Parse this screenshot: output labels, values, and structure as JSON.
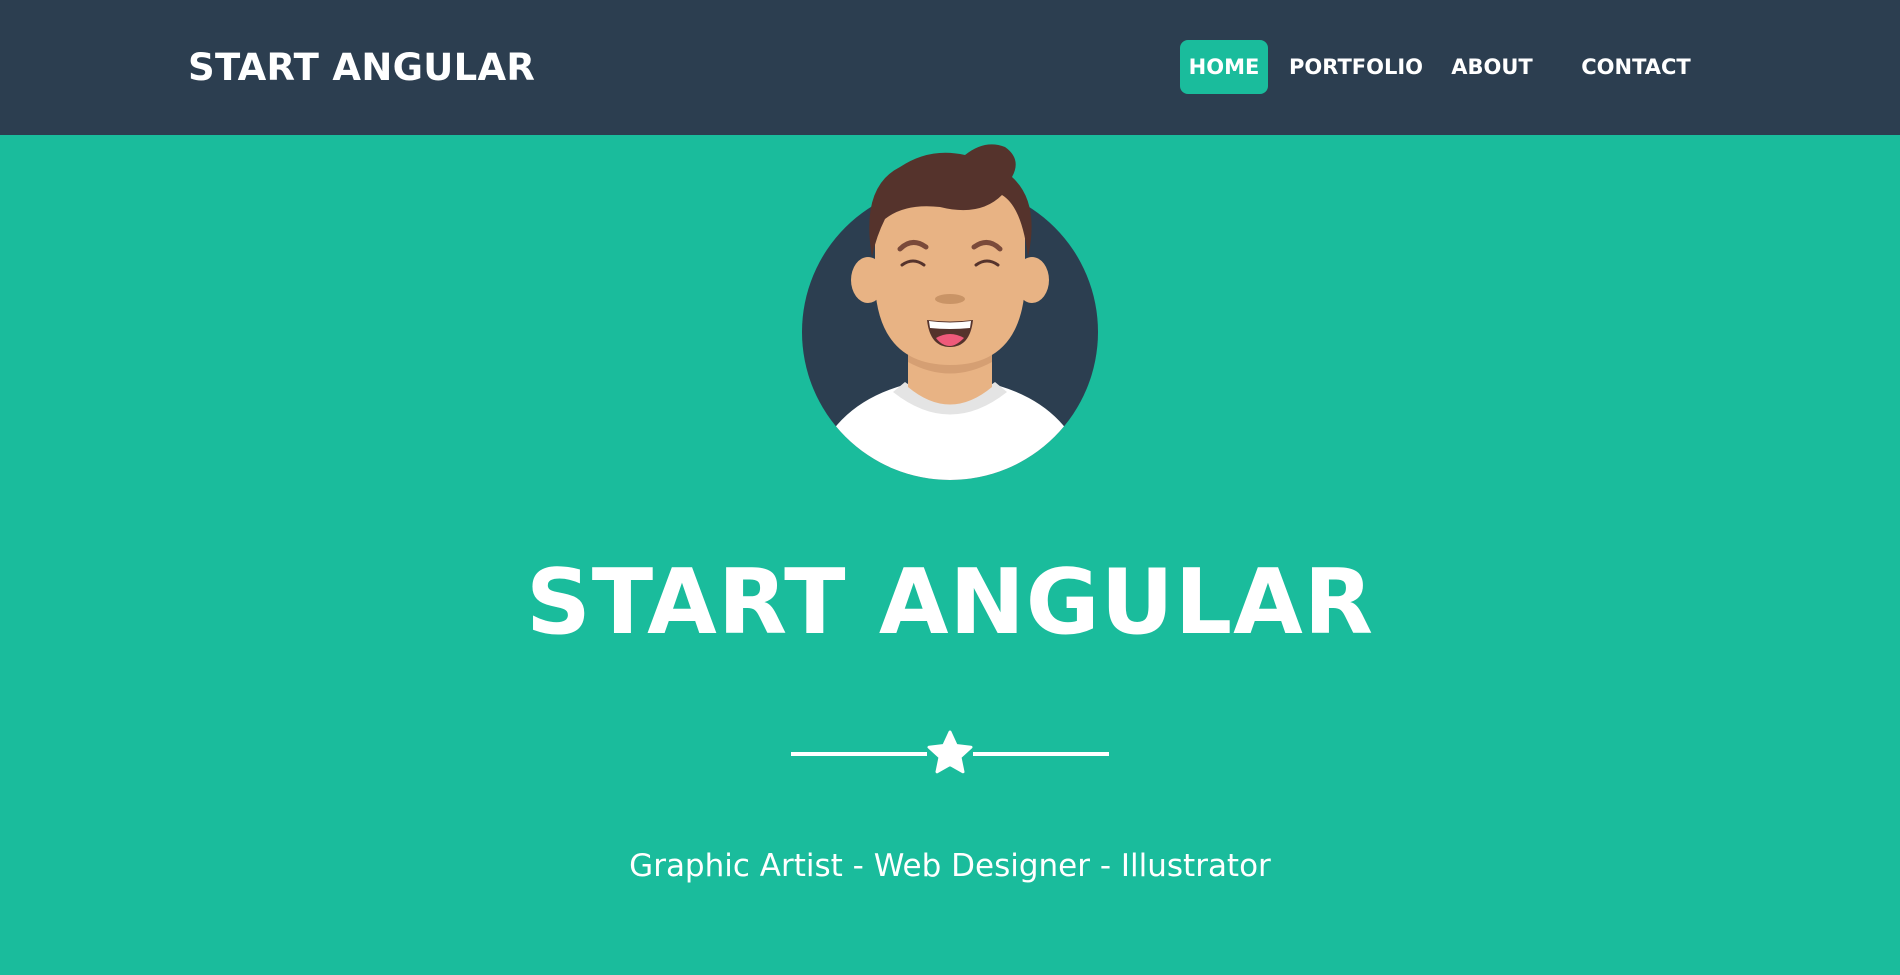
{
  "navbar": {
    "brand": "START ANGULAR",
    "items": [
      {
        "label": "HOME",
        "active": true
      },
      {
        "label": "PORTFOLIO",
        "active": false
      },
      {
        "label": "ABOUT",
        "active": false
      },
      {
        "label": "CONTACT",
        "active": false
      }
    ]
  },
  "hero": {
    "avatar_icon": "avatar-illustration",
    "title": "START ANGULAR",
    "divider_icon": "star-icon",
    "tagline": "Graphic Artist - Web Designer - Illustrator"
  },
  "colors": {
    "navbar_bg": "#2c3e50",
    "accent": "#1abc9c",
    "text": "#ffffff"
  }
}
